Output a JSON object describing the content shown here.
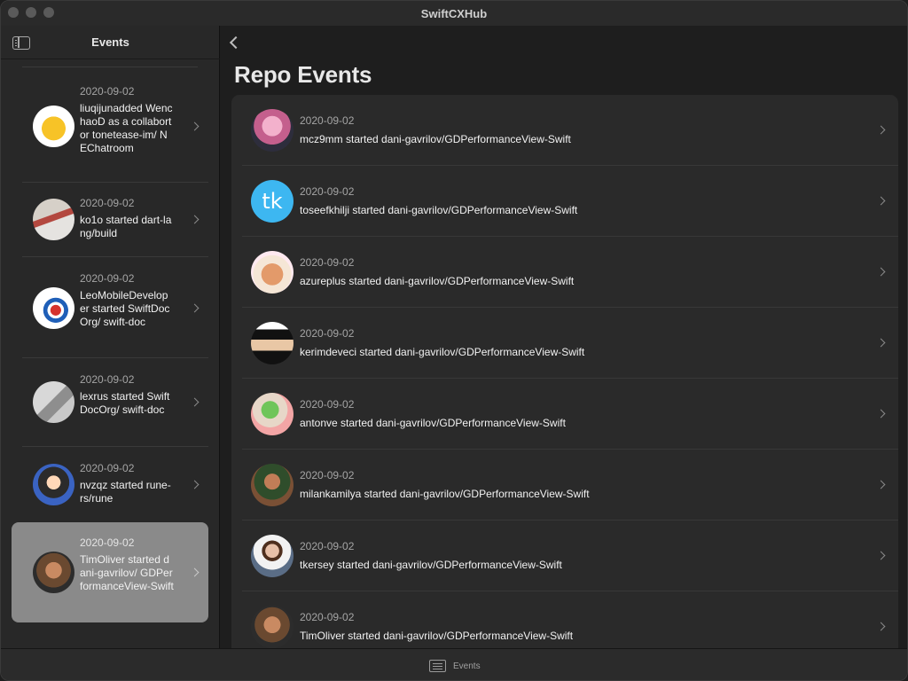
{
  "window": {
    "title": "SwiftCXHub"
  },
  "sidebar": {
    "title": "Events",
    "items": [
      {
        "date": "2020-09-02",
        "text": "liuqijunadded WenchaoD as a collabortor tonetease-im/ NEChatroom",
        "avatar": "bird-avatar"
      },
      {
        "date": "2020-09-02",
        "text": "ko1o started dart-lang/build",
        "avatar": "street-avatar"
      },
      {
        "date": "2020-09-02",
        "text": "LeoMobileDeveloper started SwiftDocOrg/ swift-doc",
        "avatar": "shield-avatar"
      },
      {
        "date": "2020-09-02",
        "text": "lexrus started SwiftDocOrg/ swift-doc",
        "avatar": "photo-avatar"
      },
      {
        "date": "2020-09-02",
        "text": "nvzqz started rune-rs/rune",
        "avatar": "person-avatar"
      },
      {
        "date": "2020-09-02",
        "text": "TimOliver started dani-gavrilov/ GDPerformanceView-Swift",
        "avatar": "person-avatar",
        "selected": true
      }
    ]
  },
  "main": {
    "title": "Repo Events",
    "events": [
      {
        "date": "2020-09-02",
        "text": "mcz9mm started dani-gavrilov/GDPerformanceView-Swift",
        "avatar": "anime-avatar"
      },
      {
        "date": "2020-09-02",
        "text": "toseefkhilji started dani-gavrilov/GDPerformanceView-Swift",
        "avatar": "tk-avatar",
        "avatar_text": "tk"
      },
      {
        "date": "2020-09-02",
        "text": "azureplus started dani-gavrilov/GDPerformanceView-Swift",
        "avatar": "cat-avatar"
      },
      {
        "date": "2020-09-02",
        "text": "kerimdeveci started dani-gavrilov/GDPerformanceView-Swift",
        "avatar": "pixel-avatar"
      },
      {
        "date": "2020-09-02",
        "text": "antonve started dani-gavrilov/GDPerformanceView-Swift",
        "avatar": "cartoon-avatar"
      },
      {
        "date": "2020-09-02",
        "text": "milankamilya started dani-gavrilov/GDPerformanceView-Swift",
        "avatar": "person-avatar"
      },
      {
        "date": "2020-09-02",
        "text": "tkersey started dani-gavrilov/GDPerformanceView-Swift",
        "avatar": "person-avatar"
      },
      {
        "date": "2020-09-02",
        "text": "TimOliver started dani-gavrilov/GDPerformanceView-Swift",
        "avatar": "person-avatar"
      }
    ]
  },
  "tabbar": {
    "tab_label": "Events",
    "tab_icon": "list-icon"
  },
  "colors": {
    "background": "#1e1e1e",
    "card": "#2a2a2a",
    "selected": "#8a8a8a",
    "secondary_text": "#a5a5a5"
  }
}
